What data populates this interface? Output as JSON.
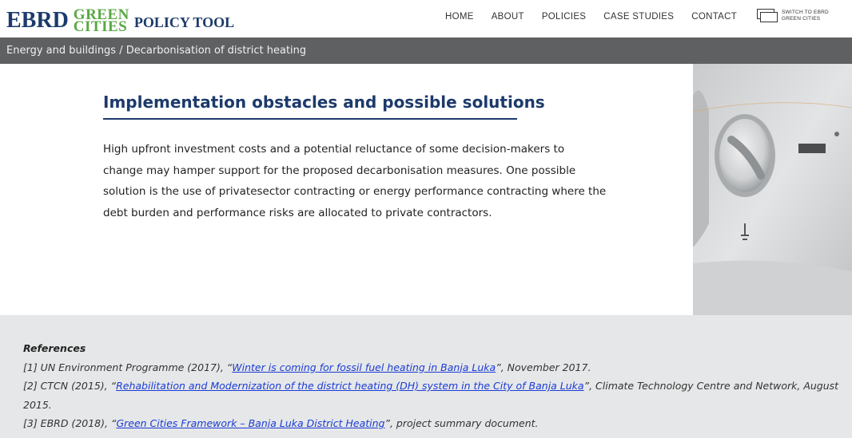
{
  "header": {
    "logo_ebrd": "EBRD",
    "logo_green": "GREEN",
    "logo_cities": "CITIES",
    "logo_policy": "POLICY TOOL",
    "nav": [
      {
        "label": "HOME"
      },
      {
        "label": "ABOUT"
      },
      {
        "label": "POLICIES"
      },
      {
        "label": "CASE STUDIES"
      },
      {
        "label": "CONTACT"
      }
    ],
    "switch_label": "SWITCH TO EBRD GREEN CITIES"
  },
  "breadcrumb": "Energy and buildings / Decarbonisation of district heating",
  "main": {
    "title": "Implementation obstacles and possible solutions",
    "body": "High upfront investment costs and a potential reluctance of some decision-makers to change may hamper support for the proposed decarbonisation measures. One possible solution is the use of privatesector contracting or energy performance contracting where the debt burden and performance risks are allocated to private contractors."
  },
  "references": {
    "title": "References",
    "items": [
      {
        "prefix": "[1] UN Environment Programme (2017), “",
        "link": "Winter is coming for fossil fuel heating in Banja Luka",
        "suffix": "”, November 2017."
      },
      {
        "prefix": "[2] CTCN (2015), “",
        "link": "Rehabilitation and Modernization of the district heating (DH) system in the City of Banja Luka",
        "suffix": "”, Climate Technology Centre and Network, August 2015."
      },
      {
        "prefix": "[3] EBRD (2018), “",
        "link": "Green Cities Framework – Banja Luka District Heating",
        "suffix": "”, project summary document."
      }
    ]
  },
  "colors": {
    "brand_navy": "#1c3a6b",
    "brand_green": "#5aa844",
    "breadcrumb_bg": "#5f6062",
    "refs_bg": "#e6e7e8",
    "link": "#1a3cd6"
  }
}
